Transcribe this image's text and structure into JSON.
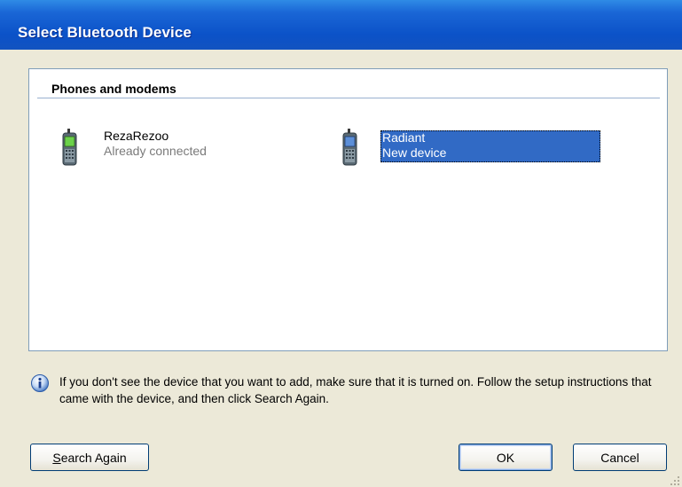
{
  "window": {
    "title": "Select Bluetooth Device"
  },
  "group": {
    "header": "Phones and modems"
  },
  "devices": [
    {
      "name": "RezaRezoo",
      "status": "Already connected",
      "icon": "phone-icon",
      "selected": false
    },
    {
      "name": "Radiant",
      "status": "New device",
      "icon": "phone-icon",
      "selected": true
    }
  ],
  "info": {
    "icon": "info-icon",
    "text": "If you don't see the device that you want to add, make sure that it is turned on. Follow the setup instructions that came with the device, and then click Search Again."
  },
  "buttons": {
    "search_again_mnemonic": "S",
    "search_again_rest": "earch Again",
    "ok": "OK",
    "cancel": "Cancel"
  },
  "colors": {
    "title_bar": "#0b52c8",
    "selection": "#316ac5",
    "dialog_bg": "#ece9d8",
    "secondary_text": "#7a7a7a"
  }
}
